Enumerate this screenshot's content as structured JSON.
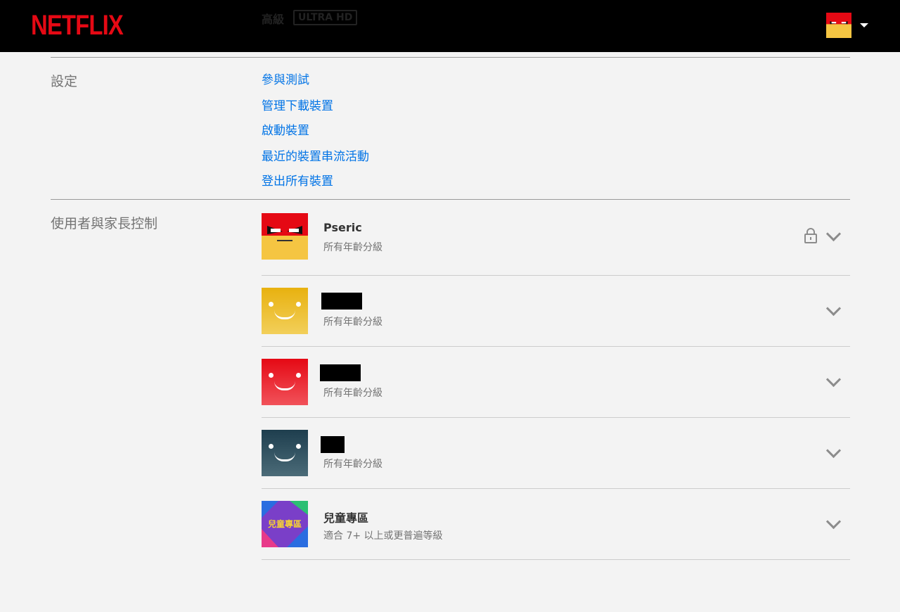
{
  "header": {
    "logo": "NETFLIX",
    "plan_label": "高級",
    "plan_badge": "ULTRA HD"
  },
  "settings": {
    "title": "設定",
    "links": [
      "參與測試",
      "管理下載裝置",
      "啟動裝置",
      "最近的裝置串流活動",
      "登出所有裝置"
    ]
  },
  "profiles_section": {
    "title": "使用者與家長控制",
    "profiles": [
      {
        "name": "Pseric",
        "rating": "所有年齡分級",
        "locked": true
      },
      {
        "name": "",
        "rating": "所有年齡分級",
        "locked": false
      },
      {
        "name": "",
        "rating": "所有年齡分級",
        "locked": false
      },
      {
        "name": "",
        "rating": "所有年齡分級",
        "locked": false
      },
      {
        "name": "兒童專區",
        "rating": "適合 7+ 以上或更普遍等級",
        "locked": false,
        "avatar_text": "兒童專區"
      }
    ]
  },
  "icons": {
    "lock": "lock-icon",
    "chevron": "chevron-down-icon",
    "caret": "caret-down-icon"
  },
  "colors": {
    "brand": "#e50914",
    "link": "#0073e6"
  }
}
